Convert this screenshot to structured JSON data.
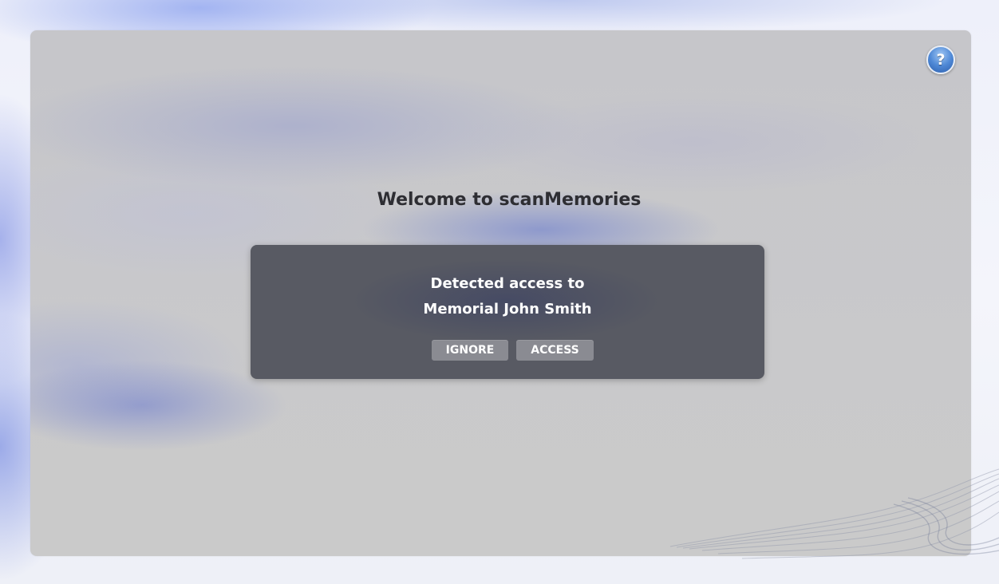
{
  "main": {
    "title": "Welcome to scanMemories"
  },
  "help_button": {
    "label": "?",
    "icon": "help-icon"
  },
  "dialog": {
    "line1": "Detected access to",
    "line2": "Memorial John Smith",
    "ignore_label": "IGNORE",
    "access_label": "ACCESS"
  },
  "colors": {
    "accent": "#4f89d6",
    "dialog_bg": "#585a63",
    "button_bg": "#8a8b92",
    "title_text": "#2e2e33"
  }
}
